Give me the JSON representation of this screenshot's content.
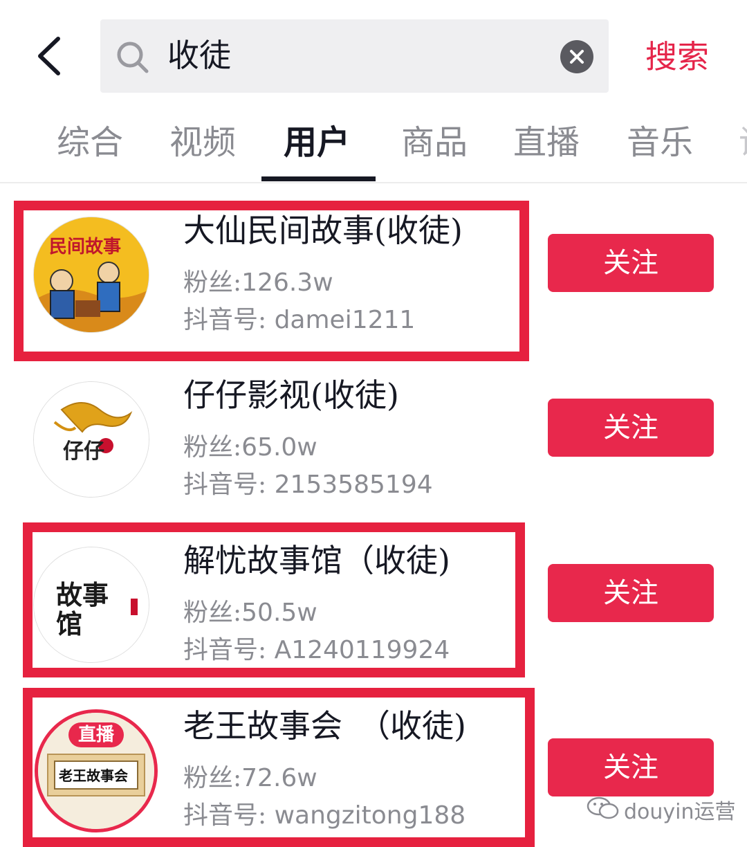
{
  "header": {
    "search_query": "收徒",
    "search_button": "搜索"
  },
  "tabs": [
    "综合",
    "视频",
    "用户",
    "商品",
    "直播",
    "音乐"
  ],
  "active_tab": "用户",
  "users": [
    {
      "name": "大仙民间故事(收徒)",
      "fans_label": "粉丝:",
      "fans": "126.3w",
      "id_label": "抖音号: ",
      "douyin_id": "damei1211",
      "follow_label": "关注",
      "avatar_text": "民间故事"
    },
    {
      "name": "仔仔影视(收徒)",
      "fans_label": "粉丝:",
      "fans": "65.0w",
      "id_label": "抖音号: ",
      "douyin_id": "2153585194",
      "follow_label": "关注",
      "avatar_text": "仔仔"
    },
    {
      "name": "解忧故事馆（收徒)",
      "fans_label": "粉丝:",
      "fans": "50.5w",
      "id_label": "抖音号: ",
      "douyin_id": "A1240119924",
      "follow_label": "关注",
      "avatar_text": "故事馆"
    },
    {
      "name": "老王故事会　（收徒)",
      "fans_label": "粉丝:",
      "fans": "72.6w",
      "id_label": "抖音号: ",
      "douyin_id": "wangzitong188",
      "follow_label": "关注",
      "avatar_badge": "直播",
      "avatar_text": "老王故事会"
    }
  ],
  "watermark": "douyin运营",
  "colors": {
    "accent": "#e8284c",
    "highlight": "#e6213f",
    "text_primary": "#161823",
    "text_secondary": "#8a8b91"
  }
}
